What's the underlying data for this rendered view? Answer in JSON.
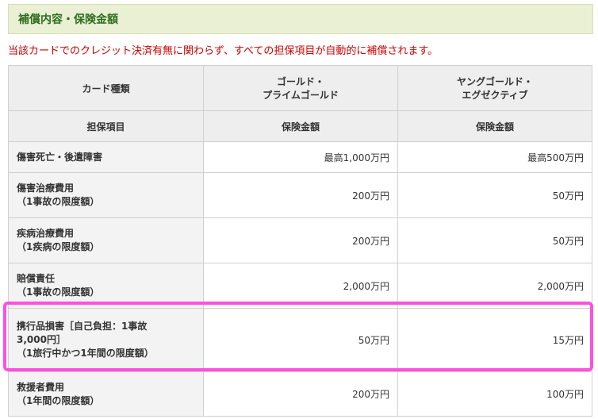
{
  "section": {
    "title": "補償内容・保険金額"
  },
  "notice": "当該カードでのクレジット決済有無に関わらず、すべての担保項目が自動的に補償されます。",
  "table": {
    "header": {
      "col_label": "カード種類",
      "col_gold": "ゴールド・\nプライムゴールド",
      "col_young": "ヤングゴールド・\nエグゼクティブ"
    },
    "subheader": {
      "col_label": "担保項目",
      "col_gold": "保険金額",
      "col_young": "保険金額"
    },
    "rows": [
      {
        "item": "傷害死亡・後遺障害",
        "gold": "最高1,000万円",
        "young": "最高500万円"
      },
      {
        "item": "傷害治療費用\n（1事故の限度額）",
        "gold": "200万円",
        "young": "50万円"
      },
      {
        "item": "疾病治療費用\n（1疾病の限度額）",
        "gold": "200万円",
        "young": "50万円"
      },
      {
        "item": "賠償責任\n（1事故の限度額）",
        "gold": "2,000万円",
        "young": "2,000万円"
      },
      {
        "item": "携行品損害［自己負担：1事故\n3,000円］\n（1旅行中かつ1年間の限度額）",
        "gold": "50万円",
        "young": "15万円"
      },
      {
        "item": "救援者費用\n（1年間の限度額）",
        "gold": "200万円",
        "young": "100万円"
      }
    ]
  },
  "colors": {
    "header_bg": "#e9f0d4",
    "header_text": "#2f6d1f",
    "notice_text": "#cc0000",
    "highlight": "#ff4fe0"
  }
}
